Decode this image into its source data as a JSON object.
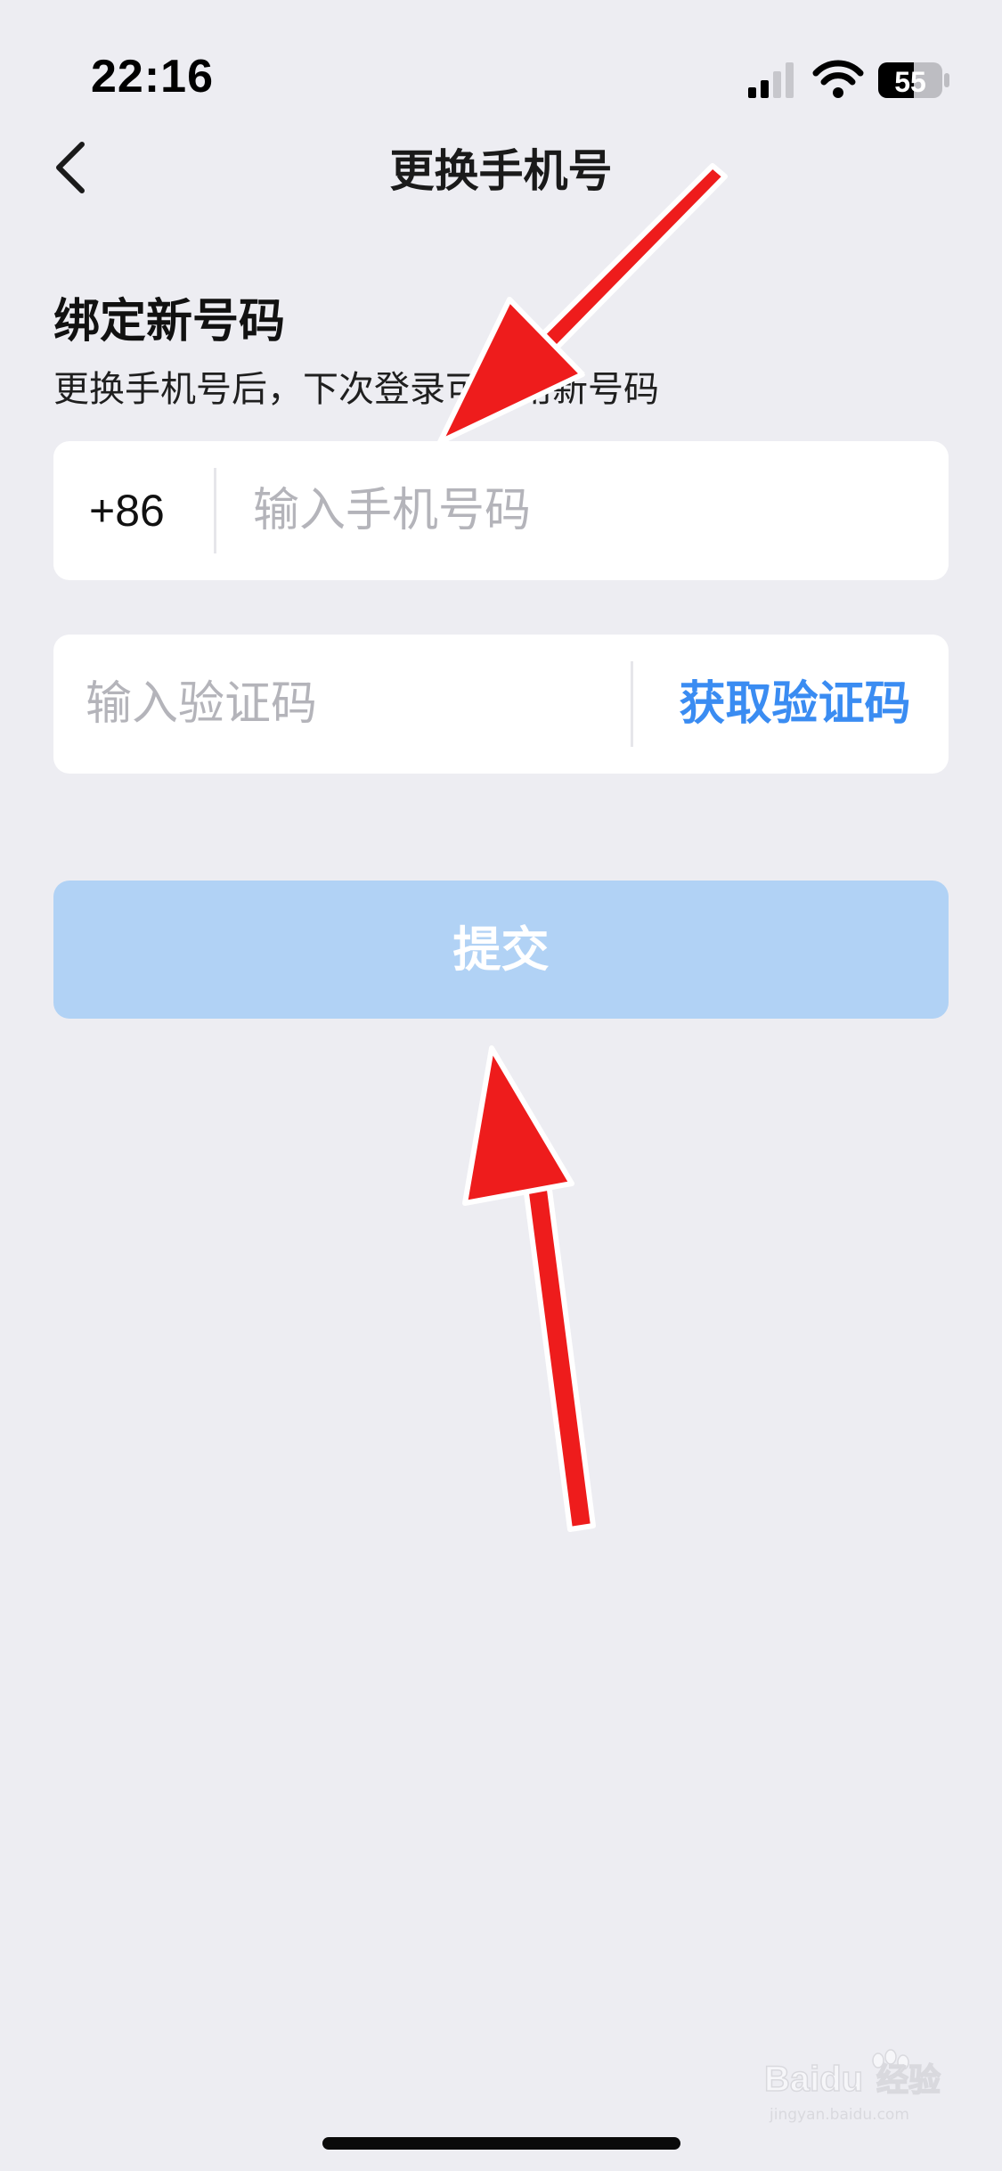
{
  "status_bar": {
    "time": "22:16",
    "battery_level": "55",
    "icons": [
      "signal-icon",
      "wifi-icon",
      "battery-icon"
    ]
  },
  "nav": {
    "title": "更换手机号",
    "back_icon": "chevron-left-icon"
  },
  "section": {
    "title": "绑定新号码",
    "subtitle": "更换手机号后，下次登录可使用新号码"
  },
  "phone_field": {
    "country_code": "+86",
    "value": "",
    "placeholder": "输入手机号码"
  },
  "code_field": {
    "value": "",
    "placeholder": "输入验证码",
    "get_code_label": "获取验证码"
  },
  "submit": {
    "label": "提交",
    "enabled": false
  },
  "colors": {
    "background": "#ededf2",
    "card": "#ffffff",
    "accent": "#3a8cf2",
    "submit_disabled": "#b1d2f5",
    "placeholder": "#b4b4ba",
    "annotation_arrow": "#ee1c1c"
  },
  "watermark": {
    "brand": "Baidu",
    "cn": "经验",
    "url": "jingyan.baidu.com"
  }
}
